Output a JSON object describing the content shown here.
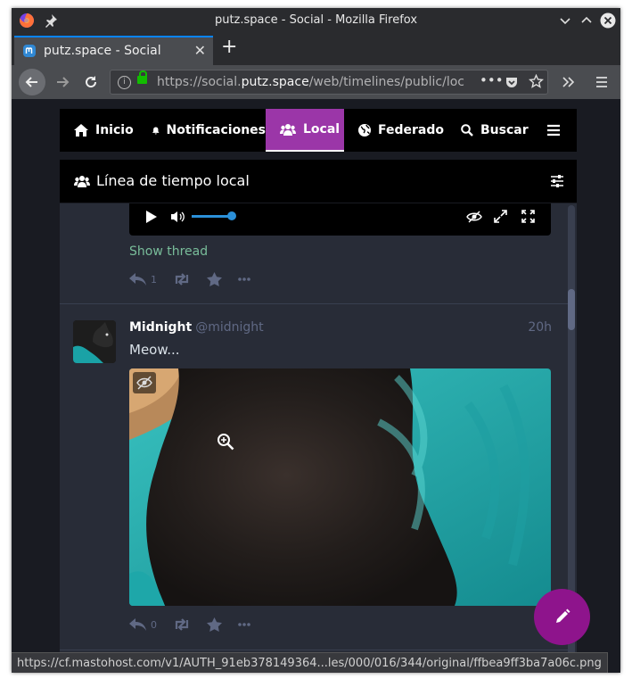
{
  "window": {
    "title": "putz.space - Social - Mozilla Firefox"
  },
  "tab": {
    "label": "putz.space - Social",
    "close": "✕"
  },
  "newtab": {
    "label": "+"
  },
  "url": {
    "prefix": "https://social.",
    "domain": "putz.space",
    "path": "/web/timelines/public/loc"
  },
  "nav": {
    "items": [
      {
        "label": "Inicio",
        "icon": "home-icon"
      },
      {
        "label": "Notificaciones",
        "icon": "bell-icon"
      },
      {
        "label": "Local",
        "icon": "users-icon"
      },
      {
        "label": "Federado",
        "icon": "globe-icon"
      },
      {
        "label": "Buscar",
        "icon": "search-icon"
      }
    ]
  },
  "column": {
    "title": "Línea de tiempo local"
  },
  "prev_post": {
    "show_thread": "Show thread",
    "replies": "1"
  },
  "post": {
    "name": "Midnight",
    "handle": "@midnight",
    "time": "20h",
    "text": "Meow...",
    "replies": "0"
  },
  "status_bar": {
    "text": "https://cf.mastohost.com/v1/AUTH_91eb378149364...les/000/016/344/original/ffbea9ff3ba7a06c.png"
  },
  "colors": {
    "accent": "#9b36a8",
    "background": "#191b22",
    "card": "#282c37",
    "link": "#79bd9a",
    "fab": "#8e148c"
  }
}
